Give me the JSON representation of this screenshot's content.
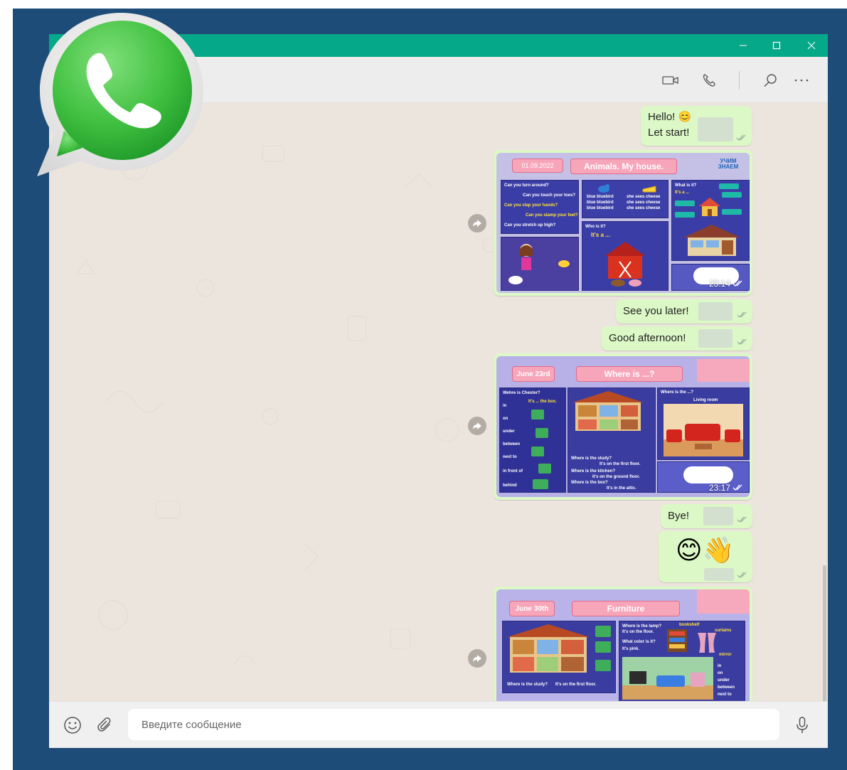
{
  "window": {
    "controls": {
      "minimize_icon": "minimize-icon",
      "maximize_icon": "maximize-icon",
      "close_icon": "close-icon"
    }
  },
  "header": {
    "icons": [
      "video-call-icon",
      "voice-call-icon",
      "search-icon",
      "more-icon"
    ]
  },
  "messages": [
    {
      "type": "text",
      "lines": [
        "Hello! 😊",
        "Let start!"
      ],
      "status": "read"
    },
    {
      "type": "image",
      "date": "01.09.2022",
      "title": "Animals. My house.",
      "brand": "УЧИМ ЗНАЕМ",
      "time": "23:14",
      "status": "read",
      "panel_texts": [
        "Can you turn around?",
        "Can you touch your toes?",
        "Can you clap your hands?",
        "Can you stamp your feet?",
        "Can you stretch up high?",
        "blue bluebird",
        "blue bluebird",
        "blue bluebird",
        "she sees cheese",
        "she sees cheese",
        "she sees cheese",
        "What is it?",
        "It's a ...",
        "Who is it?",
        "It's a ..."
      ]
    },
    {
      "type": "text",
      "lines": [
        "See you later!"
      ],
      "status": "read"
    },
    {
      "type": "text",
      "lines": [
        "Good afternoon!"
      ],
      "status": "read"
    },
    {
      "type": "image",
      "date": "June 23rd",
      "title": "Where is ...?",
      "time": "23:17",
      "status": "read",
      "panel_texts": [
        "Wehre is Chester?",
        "It's ... the box.",
        "in",
        "on",
        "under",
        "between",
        "next to",
        "in front of",
        "behind",
        "Where is the study?",
        "It's on the first floor.",
        "Where is the kitchen?",
        "It's on the ground floor.",
        "Where is the box?",
        "It's in the attic.",
        "Where is the ...?",
        "Living room"
      ]
    },
    {
      "type": "text",
      "lines": [
        "Bye!"
      ],
      "status": "read"
    },
    {
      "type": "emoji",
      "emoji": "😊👋",
      "status": "read"
    },
    {
      "type": "image",
      "date": "June 30th",
      "title": "Furniture",
      "panel_texts": [
        "Where is the study?",
        "It's on the first floor.",
        "Where is the lamp?",
        "It's on the floor.",
        "What color is it?",
        "It's pink.",
        "bookshelf",
        "curtains",
        "mirror",
        "in",
        "on",
        "under",
        "between",
        "next to"
      ]
    }
  ],
  "composer": {
    "placeholder": "Введите сообщение",
    "value": "",
    "emoji_icon": "emoji-icon",
    "attach_icon": "attach-icon",
    "mic_icon": "mic-icon"
  },
  "colors": {
    "frame": "#1e4c78",
    "titlebar": "#06a88a",
    "outgoing_bubble": "#dcf8c6",
    "chat_background": "#ece5dd",
    "tick_read": "#93a89a",
    "whatsapp_green": "#3fc44e"
  },
  "logo": {
    "name": "whatsapp-logo"
  }
}
